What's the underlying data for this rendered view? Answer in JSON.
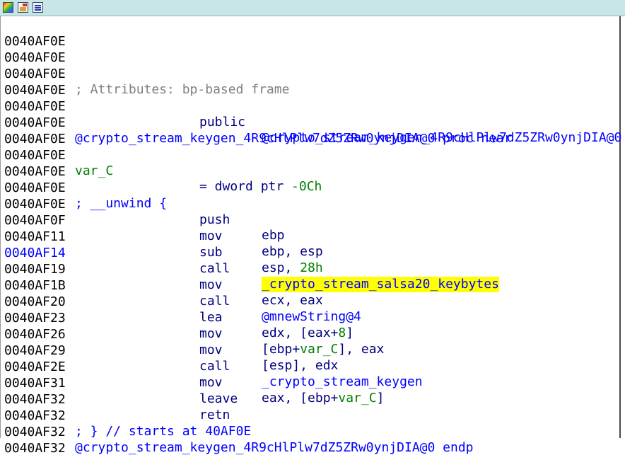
{
  "window": {
    "toolbar_icons": [
      "graph-view-icon",
      "edit-function-icon",
      "listing-options-icon"
    ]
  },
  "listing": {
    "lines": [
      {
        "addr": "0040AF0E"
      },
      {
        "addr": "0040AF0E"
      },
      {
        "addr": "0040AF0E",
        "code": "; Attributes: bp-based frame"
      },
      {
        "addr": "0040AF0E"
      },
      {
        "addr": "0040AF0E",
        "mnem": "public",
        "op": "@crypto_stream_keygen_4R9cHlPlw7dZ5ZRw0ynjDIA@0"
      },
      {
        "addr": "0040AF0E",
        "code": "@crypto_stream_keygen_4R9cHlPlw7dZ5ZRw0ynjDIA@0 proc near"
      },
      {
        "addr": "0040AF0E"
      },
      {
        "addr": "0040AF0E",
        "code": "var_C",
        "op_pre": "= dword ptr ",
        "op_num": "-0Ch"
      },
      {
        "addr": "0040AF0E"
      },
      {
        "addr": "0040AF0E",
        "code": "; __unwind {"
      },
      {
        "addr": "0040AF0E",
        "mnem": "push",
        "op": "ebp"
      },
      {
        "addr": "0040AF0F",
        "mnem": "mov",
        "op": "ebp, esp"
      },
      {
        "addr": "0040AF11",
        "mnem": "sub",
        "op_pre": "esp, ",
        "op_num": "28h"
      },
      {
        "addr": "0040AF14",
        "mnem": "call",
        "op": "_crypto_stream_salsa20_keybytes"
      },
      {
        "addr": "0040AF19",
        "mnem": "mov",
        "op": "ecx, eax"
      },
      {
        "addr": "0040AF1B",
        "mnem": "call",
        "op": "@mnewString@4"
      },
      {
        "addr": "0040AF20",
        "mnem": "lea",
        "op_pre": "edx, [eax+",
        "op_num": "8",
        "op_post": "]"
      },
      {
        "addr": "0040AF23",
        "mnem": "mov",
        "op_pre": "[ebp+",
        "op_var": "var_C",
        "op_post": "], eax"
      },
      {
        "addr": "0040AF26",
        "mnem": "mov",
        "op": "[esp], edx"
      },
      {
        "addr": "0040AF29",
        "mnem": "call",
        "op": "_crypto_stream_keygen"
      },
      {
        "addr": "0040AF2E",
        "mnem": "mov",
        "op_pre": "eax, [ebp+",
        "op_var": "var_C",
        "op_post": "]"
      },
      {
        "addr": "0040AF31",
        "mnem": "leave"
      },
      {
        "addr": "0040AF32",
        "mnem": "retn"
      },
      {
        "addr": "0040AF32",
        "code": "; } // starts at 40AF0E"
      },
      {
        "addr": "0040AF32",
        "code": "@crypto_stream_keygen_4R9cHlPlw7dZ5ZRw0ynjDIA@0 endp"
      },
      {
        "addr": "0040AF32"
      }
    ]
  },
  "colors": {
    "background": "#ffffff",
    "address": "#000000",
    "current_address": "#0000ff",
    "instruction": "#000080",
    "comment": "#808080",
    "number_and_local_var": "#008000",
    "highlight": "#ffff00",
    "titlebar": "#c9e6e6"
  }
}
